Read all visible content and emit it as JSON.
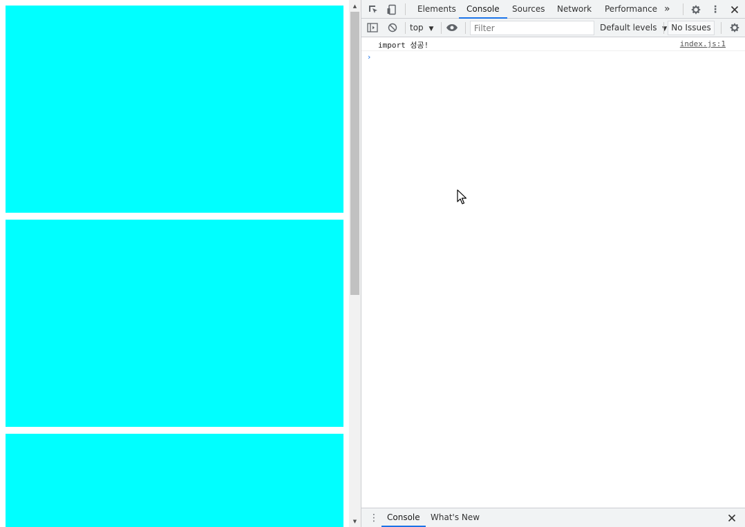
{
  "devtools": {
    "tabs": [
      "Elements",
      "Console",
      "Sources",
      "Network",
      "Performance"
    ],
    "more_tabs_label": "»"
  },
  "toolbar": {
    "context": "top",
    "filter_placeholder": "Filter",
    "levels_label": "Default levels",
    "issues_label": "No Issues"
  },
  "console": {
    "message": "import 성공!",
    "source": "index.js:1",
    "prompt": "›"
  },
  "drawer": {
    "tabs": [
      "Console",
      "What's New"
    ]
  },
  "colors": {
    "box": "#00ffff",
    "accent": "#1a73e8"
  }
}
